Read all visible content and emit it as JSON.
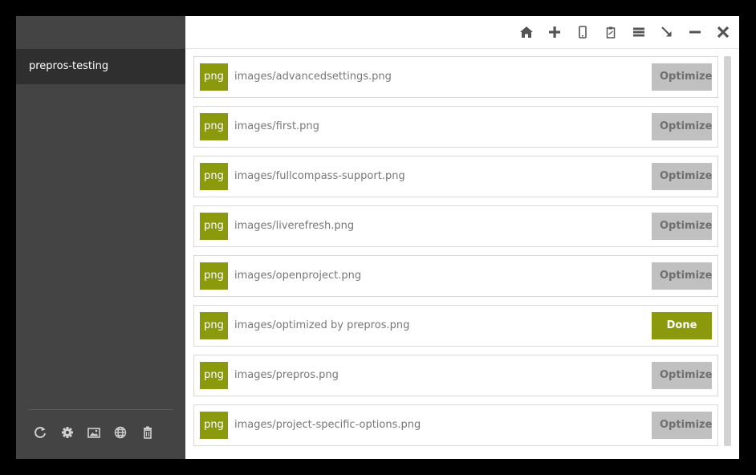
{
  "sidebar": {
    "project_name": "prepros-testing",
    "tools": [
      {
        "icon": "refresh-icon"
      },
      {
        "icon": "gear-icon"
      },
      {
        "icon": "image-icon"
      },
      {
        "icon": "globe-icon"
      },
      {
        "icon": "trash-icon"
      }
    ]
  },
  "toolbar": {
    "icons": [
      "home-icon",
      "plus-icon",
      "mobile-icon",
      "clipboard-icon",
      "menu-icon",
      "arrow-down-right-icon",
      "minimize-icon",
      "close-icon"
    ]
  },
  "files": [
    {
      "ext": "png",
      "path": "images/advancedsettings.png",
      "action": "Optimize",
      "done": false
    },
    {
      "ext": "png",
      "path": "images/first.png",
      "action": "Optimize",
      "done": false
    },
    {
      "ext": "png",
      "path": "images/fullcompass-support.png",
      "action": "Optimize",
      "done": false
    },
    {
      "ext": "png",
      "path": "images/liverefresh.png",
      "action": "Optimize",
      "done": false
    },
    {
      "ext": "png",
      "path": "images/openproject.png",
      "action": "Optimize",
      "done": false
    },
    {
      "ext": "png",
      "path": "images/optimized by prepros.png",
      "action": "Done",
      "done": true
    },
    {
      "ext": "png",
      "path": "images/prepros.png",
      "action": "Optimize",
      "done": false
    },
    {
      "ext": "png",
      "path": "images/project-specific-options.png",
      "action": "Optimize",
      "done": false
    }
  ],
  "colors": {
    "accent": "#8a9a0c",
    "sidebar_bg": "#444444",
    "sidebar_active": "#2f2f2f",
    "button_gray": "#c0c0c0"
  }
}
